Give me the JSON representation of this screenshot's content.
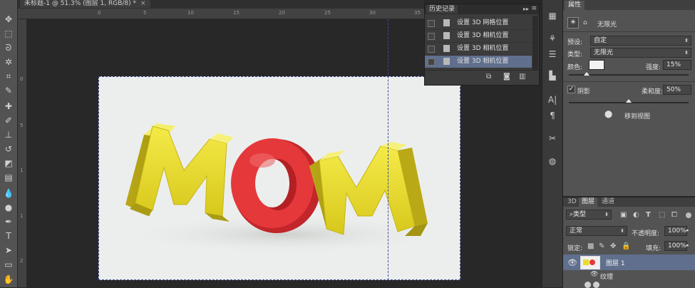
{
  "document": {
    "tab_title": "未标题-1 @ 51.3% (图层 1, RGB/8) *",
    "close_glyph": "×"
  },
  "ruler": {
    "top_numbers": [
      "0",
      "5",
      "10",
      "15",
      "20",
      "25",
      "30",
      "35"
    ],
    "left_numbers": [
      "0",
      "5",
      "1",
      "1",
      "2"
    ]
  },
  "canvas": {
    "letters": [
      "M",
      "O",
      "M"
    ],
    "letter_colors": {
      "yellow": "#e9dd2a",
      "red": "#e5383b"
    }
  },
  "history": {
    "title": "历史记录",
    "collapse_glyph": "▸▸",
    "menu_glyph": "≡",
    "items": [
      {
        "label": "设置 3D 网格位置",
        "selected": false
      },
      {
        "label": "设置 3D 相机位置",
        "selected": false
      },
      {
        "label": "设置 3D 相机位置",
        "selected": false
      },
      {
        "label": "设置 3D 相机位置",
        "selected": true
      }
    ]
  },
  "properties": {
    "tab": "属性",
    "light_name": "无限光",
    "preset_label": "预设:",
    "preset_value": "自定",
    "type_label": "类型:",
    "type_value": "无限光",
    "color_label": "颜色:",
    "color_value": "#f2f2f2",
    "intensity_label": "强度:",
    "intensity_value": "15%",
    "intensity_level": 0.15,
    "shadow_label": "阴影",
    "shadow_checked": true,
    "softness_label": "柔和度:",
    "softness_value": "50%",
    "softness_level": 0.5,
    "move_to_view": "移到视图"
  },
  "layers": {
    "tabs": [
      "3D",
      "图层",
      "通道"
    ],
    "active_tab": "图层",
    "kind_filter": "类型",
    "blend_mode": "正常",
    "opacity_label": "不透明度:",
    "opacity_value": "100%",
    "lock_label": "锁定:",
    "fill_label": "填充:",
    "fill_value": "100%",
    "layer_name": "图层 1",
    "texture_label": "纹理"
  },
  "colors": {
    "selection": "#5f6f8d",
    "panel": "#535353",
    "dark": "#282828"
  }
}
